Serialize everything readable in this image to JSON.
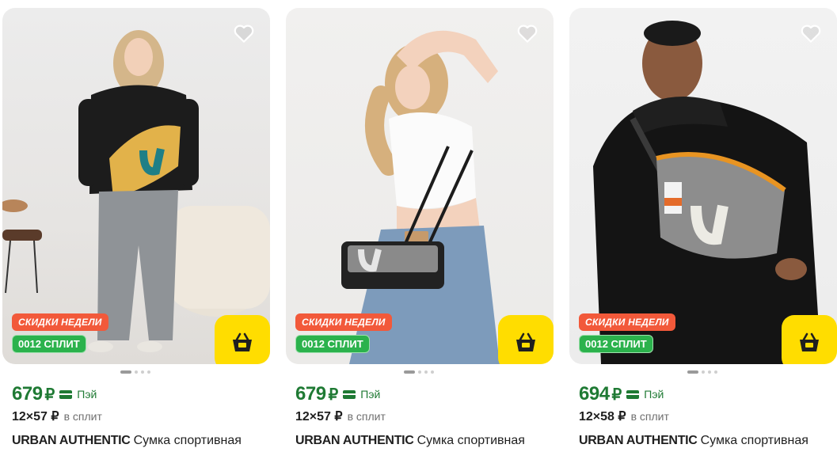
{
  "products": [
    {
      "badge_sale": "СКИДКИ НЕДЕЛИ",
      "badge_split": "0012 СПЛИТ",
      "price": "679",
      "currency": "₽",
      "pay_label": "Пэй",
      "split_amount": "12×57 ₽",
      "split_text": "в сплит",
      "brand": "URBAN AUTHENTIC",
      "name": "Сумка спортивная"
    },
    {
      "badge_sale": "СКИДКИ НЕДЕЛИ",
      "badge_split": "0012 СПЛИТ",
      "price": "679",
      "currency": "₽",
      "pay_label": "Пэй",
      "split_amount": "12×57 ₽",
      "split_text": "в сплит",
      "brand": "URBAN AUTHENTIC",
      "name": "Сумка спортивная"
    },
    {
      "badge_sale": "СКИДКИ НЕДЕЛИ",
      "badge_split": "0012 СПЛИТ",
      "price": "694",
      "currency": "₽",
      "pay_label": "Пэй",
      "split_amount": "12×58 ₽",
      "split_text": "в сплит",
      "brand": "URBAN AUTHENTIC",
      "name": "Сумка спортивная"
    }
  ],
  "icons": {
    "favorite": "heart-icon",
    "cart": "basket-icon",
    "pay": "card-icon"
  },
  "colors": {
    "price_green": "#1f7a34",
    "sale_badge": "#f2593a",
    "split_badge": "#2bb24c",
    "cart_button": "#ffdd00"
  },
  "carousel": {
    "total_images": 4,
    "active_index": 0
  }
}
